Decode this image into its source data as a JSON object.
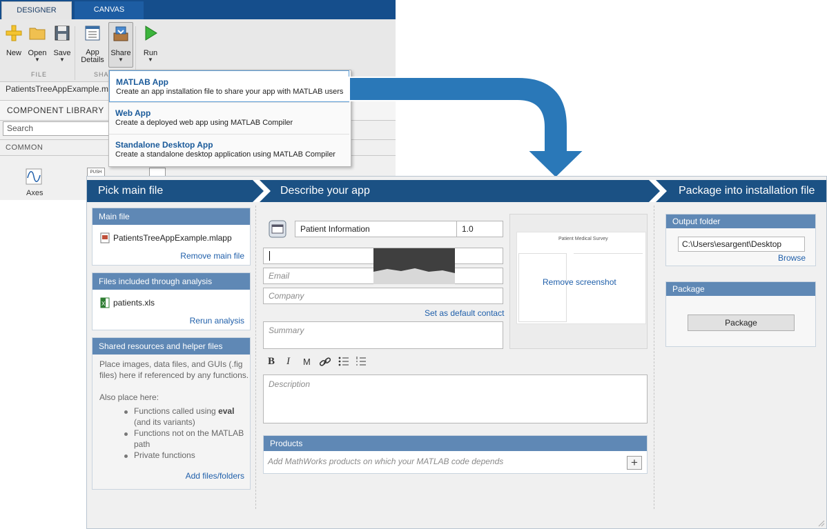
{
  "designer": {
    "tabs": [
      "DESIGNER",
      "CANVAS"
    ],
    "toolbar": {
      "new_label": "New",
      "open_label": "Open",
      "save_label": "Save",
      "app_details_label_1": "App",
      "app_details_label_2": "Details",
      "share_label": "Share",
      "run_label": "Run",
      "arrow": "▼"
    },
    "sections": {
      "file": "FILE",
      "share": "SHA"
    },
    "file_path": "PatientsTreeAppExample.mlapp",
    "component_library": {
      "title": "COMPONENT LIBRARY",
      "search_placeholder": "Search",
      "category": "COMMON",
      "components": [
        "Axes"
      ],
      "push_label": "PUSH"
    }
  },
  "share_menu": {
    "items": [
      {
        "title": "MATLAB App",
        "description": "Create an app installation file to share your app with MATLAB users"
      },
      {
        "title": "Web App",
        "description": "Create a deployed web app using MATLAB Compiler"
      },
      {
        "title": "Standalone Desktop App",
        "description": "Create a standalone desktop application using MATLAB Compiler"
      }
    ]
  },
  "packager": {
    "steps": [
      "Pick main file",
      "Describe your app",
      "Package into installation file"
    ],
    "main_file": {
      "header": "Main file",
      "file": "PatientsTreeAppExample.mlapp",
      "remove_link": "Remove main file"
    },
    "included_files": {
      "header": "Files included through analysis",
      "file": "patients.xls",
      "rerun_link": "Rerun analysis"
    },
    "shared_resources": {
      "header": "Shared resources and helper files",
      "intro": "Place images, data files, and GUIs (.fig files) here if referenced by any functions.",
      "also": "Also place here:",
      "bullet1_pre": "Functions called using ",
      "bullet1_bold": "eval",
      "bullet1_post": " (and its variants)",
      "bullet2": "Functions not on the MATLAB path",
      "bullet3": "Private functions",
      "add_link": "Add files/folders"
    },
    "describe": {
      "app_name": "Patient Information",
      "version": "1.0",
      "author_value": "",
      "email_placeholder": "Email",
      "company_placeholder": "Company",
      "default_contact_link": "Set as default contact",
      "summary_placeholder": "Summary",
      "format_buttons": [
        "B",
        "I",
        "M"
      ],
      "description_placeholder": "Description",
      "remove_screenshot": "Remove screenshot",
      "screenshot_title": "Patient Medical Survey",
      "products_header": "Products",
      "products_placeholder": "Add MathWorks products on which your MATLAB code depends",
      "add_symbol": "+"
    },
    "package": {
      "output_header": "Output folder",
      "output_path": "C:\\Users\\esargent\\Desktop",
      "browse_link": "Browse",
      "package_header": "Package",
      "package_button": "Package"
    }
  },
  "colors": {
    "tab_bar": "#154e8c",
    "step_bar": "#1b5184",
    "panel_header": "#5f88b5",
    "link": "#1f5faa",
    "arrow": "#2a78b8"
  }
}
